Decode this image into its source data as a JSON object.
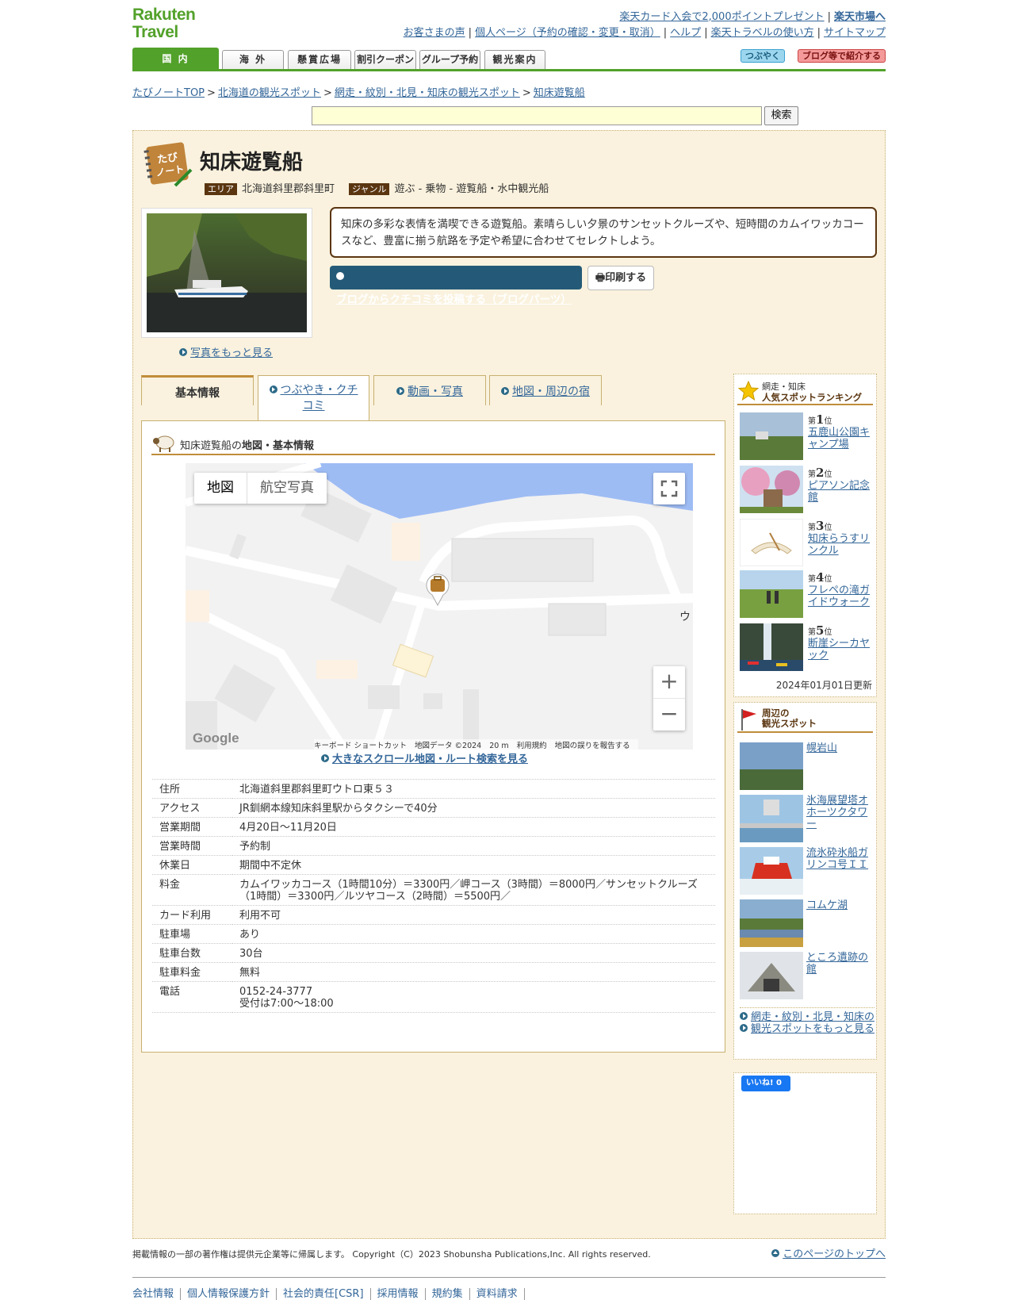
{
  "header": {
    "logo_line1": "Rakuten",
    "logo_line2": "Travel",
    "toplinks_row1": {
      "card_link": "楽天カード入会で2,000ポイントプレゼント",
      "ichiba_link": "楽天市場へ"
    },
    "toplinks_row2": [
      "お客さまの声",
      "個人ページ（予約の確認・変更・取消）",
      "ヘルプ",
      "楽天トラベルの使い方",
      "サイトマップ"
    ]
  },
  "nav": {
    "tabs": [
      "国 内",
      "海 外",
      "懸賞広場",
      "割引クーポン",
      "グループ予約",
      "観光案内"
    ],
    "tsubuyaku": "つぶやく",
    "blog_share": "ブログ等で紹介する"
  },
  "breadcrumb": [
    "たびノートTOP",
    "北海道の観光スポット",
    "網走・紋別・北見・知床の観光スポット",
    "知床遊覧船"
  ],
  "search": {
    "button": "検索",
    "value": ""
  },
  "spot": {
    "notebook_label": "たび ノート",
    "title": "知床遊覧船",
    "area_tag": "エリア",
    "area_value": "北海道斜里郡斜里町",
    "genre_tag": "ジャンル",
    "genre_value": "遊ぶ - 乗物 - 遊覧船・水中観光船",
    "description": "知床の多彩な表情を満喫できる遊覧船。素晴らしい夕景のサンセットクルーズや、短時間のカムイワッカコースなど、豊富に揃う航路を予定や希望に合わせてセレクトしよう。",
    "blog_button": "ブログからクチコミを投稿する（ブログパーツ）",
    "print_button": "印刷する",
    "more_photos": "写真をもっと見る"
  },
  "tabs": [
    {
      "label": "基本情報"
    },
    {
      "label": "つぶやき・クチコミ"
    },
    {
      "label": "動画・写真"
    },
    {
      "label": "地図・周辺の宿"
    }
  ],
  "section": {
    "prefix": "知床遊覧船の",
    "title": "地図・基本情報"
  },
  "map": {
    "type_map": "地図",
    "type_aerial": "航空写真",
    "footer_shortcuts": "キーボード ショートカット",
    "footer_data": "地図データ ©2024",
    "footer_scale": "20 m",
    "footer_terms": "利用規約",
    "footer_report": "地図の誤りを報告する",
    "google_logo": "Google",
    "label_u": "ウ",
    "big_map_link": "大きなスクロール地図・ルート検索を見る"
  },
  "info": [
    {
      "label": "住所",
      "value": "北海道斜里郡斜里町ウトロ東５３"
    },
    {
      "label": "アクセス",
      "value": "JR釧網本線知床斜里駅からタクシーで40分"
    },
    {
      "label": "営業期間",
      "value": "4月20日～11月20日"
    },
    {
      "label": "営業時間",
      "value": "予約制"
    },
    {
      "label": "休業日",
      "value": "期間中不定休"
    },
    {
      "label": "料金",
      "value": "カムイワッカコース（1時間10分）＝3300円／岬コース（3時間）＝8000円／サンセットクルーズ（1時間）＝3300円／ルツヤコース（2時間）＝5500円／"
    },
    {
      "label": "カード利用",
      "value": "利用不可"
    },
    {
      "label": "駐車場",
      "value": "あり"
    },
    {
      "label": "駐車台数",
      "value": "30台"
    },
    {
      "label": "駐車料金",
      "value": "無料"
    },
    {
      "label": "電話",
      "value": "0152-24-3777",
      "value2": "受付は7:00～18:00"
    }
  ],
  "ranking": {
    "area": "網走・知床",
    "title": "人気スポットランキング",
    "rank_prefix": "第",
    "rank_suffix": "位",
    "items": [
      {
        "rank": "1",
        "name": "五鹿山公園キャンプ場"
      },
      {
        "rank": "2",
        "name": "ピアソン記念館"
      },
      {
        "rank": "3",
        "name": "知床らうすリンクル"
      },
      {
        "rank": "4",
        "name": "フレペの滝ガイドウォーク"
      },
      {
        "rank": "5",
        "name": "断崖シーカヤック"
      }
    ],
    "updated": "2024年01月01日更新"
  },
  "nearby": {
    "title_line1": "周辺の",
    "title_line2": "観光スポット",
    "items": [
      "幌岩山",
      "氷海展望塔オホーツクタワー",
      "流氷砕氷船ガリンコ号ＩＩ",
      "コムケ湖",
      "ところ遺跡の館"
    ],
    "more_line1": "網走・紋別・北見・知床の",
    "more_line2": "観光スポットをもっと見る"
  },
  "like": {
    "label": "いいね! 0"
  },
  "footer": {
    "copyright": "掲載情報の一部の著作権は提供元企業等に帰属します。 Copyright（C）2023 Shobunsha Publications,Inc. All rights reserved.",
    "pagetop": "このページのトップへ",
    "links": [
      "会社情報",
      "個人情報保護方針",
      "社会的責任[CSR]",
      "採用情報",
      "規約集",
      "資料請求"
    ]
  }
}
